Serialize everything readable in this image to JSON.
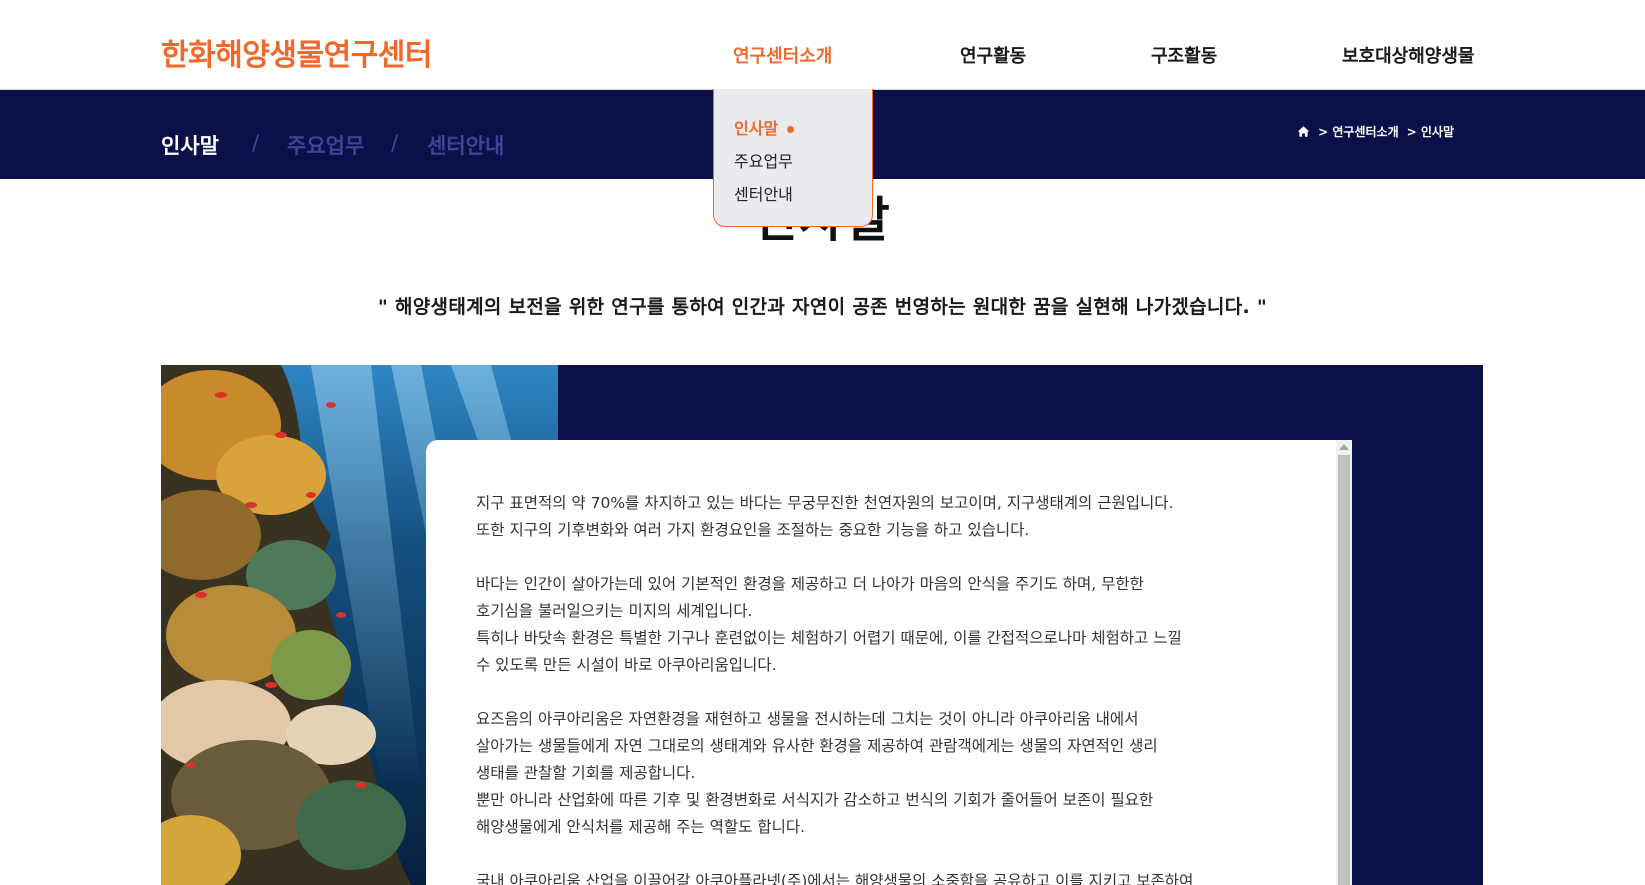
{
  "header": {
    "logo": "한화해양생물연구센터",
    "nav": [
      {
        "label": "연구센터소개",
        "active": true
      },
      {
        "label": "연구활동",
        "active": false
      },
      {
        "label": "구조활동",
        "active": false
      },
      {
        "label": "보호대상해양생물",
        "active": false
      }
    ]
  },
  "dropdown": {
    "items": [
      {
        "label": "인사말",
        "active": true
      },
      {
        "label": "주요업무",
        "active": false
      },
      {
        "label": "센터안내",
        "active": false
      }
    ]
  },
  "subnav": {
    "tabs": [
      {
        "label": "인사말",
        "current": true
      },
      {
        "label": "주요업무",
        "current": false
      },
      {
        "label": "센터안내",
        "current": false
      }
    ],
    "separator": "/"
  },
  "breadcrumb": {
    "icon": "home-icon",
    "items": [
      "> 연구센터소개",
      "> 인사말"
    ]
  },
  "page": {
    "title": "인사말",
    "slogan": "\" 해양생태계의 보전을 위한 연구를 통하여 인간과 자연이 공존 번영하는 원대한 꿈을 실현해 나가겠습니다. \""
  },
  "greeting": {
    "lines": [
      "지구 표면적의 약 70%를 차지하고 있는 바다는 무궁무진한 천연자원의 보고이며, 지구생태계의 근원입니다.",
      "또한 지구의 기후변화와 여러 가지 환경요인을 조절하는 중요한 기능을 하고 있습니다.",
      "바다는 인간이 살아가는데 있어 기본적인 환경을 제공하고 더 나아가 마음의 안식을 주기도 하며, 무한한",
      "호기심을 불러일으키는 미지의 세계입니다.",
      "특히나 바닷속 환경은 특별한 기구나 훈련없이는 체험하기 어렵기 때문에, 이를 간접적으로나마 체험하고 느낄",
      "수 있도록 만든 시설이 바로 아쿠아리움입니다.",
      "요즈음의 아쿠아리움은 자연환경을 재현하고 생물을 전시하는데 그치는 것이 아니라 아쿠아리움 내에서",
      "살아가는 생물들에게 자연 그대로의 생태계와 유사한 환경을 제공하여 관람객에게는 생물의 자연적인 생리",
      "생태를 관찰할 기회를 제공합니다.",
      "뿐만 아니라 산업화에 따른 기후 및 환경변화로 서식지가 감소하고 번식의 기회가 줄어들어 보존이 필요한",
      "해양생물에게 안식처를 제공해 주는 역할도 합니다.",
      "국내 아쿠아리움 산업을 이끌어갈 아쿠아플라넷(주)에서는 해양생물의 소중함을 공유하고 이를 지키고 보존하여"
    ]
  },
  "colors": {
    "accent": "#ee6a2c",
    "navy": "#0c1048",
    "dim_tab": "#3c4598"
  }
}
